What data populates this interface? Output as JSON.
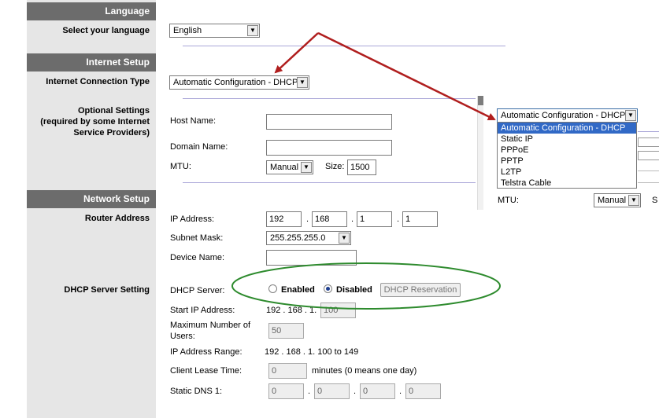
{
  "sections": {
    "language": "Language",
    "internet_setup": "Internet Setup",
    "network_setup": "Network Setup"
  },
  "side_labels": {
    "select_language": "Select your language",
    "connection_type": "Internet Connection Type",
    "optional_settings": "Optional Settings",
    "optional_note_1": "(required by some Internet",
    "optional_note_2": "Service Providers)",
    "router_address": "Router Address",
    "dhcp_server_setting": "DHCP Server Setting"
  },
  "language_select": {
    "value": "English"
  },
  "connection_select": {
    "value": "Automatic Configuration - DHCP"
  },
  "optional": {
    "host_name_label": "Host Name:",
    "domain_name_label": "Domain Name:",
    "mtu_label": "MTU:",
    "mtu_value": "Manual",
    "size_label": "Size:",
    "size_value": "1500"
  },
  "popup": {
    "value": "Automatic Configuration - DHCP",
    "options": [
      "Automatic Configuration - DHCP",
      "Static IP",
      "PPPoE",
      "PPTP",
      "L2TP",
      "Telstra Cable"
    ],
    "mtu_label": "MTU:",
    "mtu_value": "Manual",
    "partial_s": "S"
  },
  "router": {
    "ip_label": "IP Address:",
    "ip": [
      "192",
      "168",
      "1",
      "1"
    ],
    "subnet_label": "Subnet Mask:",
    "subnet_value": "255.255.255.0",
    "device_label": "Device Name:"
  },
  "dhcp": {
    "server_label": "DHCP Server:",
    "enabled_label": "Enabled",
    "disabled_label": "Disabled",
    "reservation_button": "DHCP Reservation",
    "start_ip_label": "Start IP  Address:",
    "start_ip_prefix": "192 . 168 . 1.",
    "start_ip_value": "100",
    "max_users_label_1": "Maximum Number of",
    "max_users_label_2": "Users:",
    "max_users_value": "50",
    "range_label": "IP Address Range:",
    "range_value": "192 . 168 . 1. 100 to 149",
    "lease_label": "Client Lease Time:",
    "lease_value": "0",
    "lease_suffix": "minutes (0 means one day)",
    "dns1_label": "Static DNS 1:",
    "dns1": [
      "0",
      "0",
      "0",
      "0"
    ]
  },
  "colors": {
    "section_header": "#6c6c6c",
    "sidebar": "#e6e6e6",
    "divider": "#a9a6d8",
    "arrow": "#b01e1e",
    "highlight_ellipse": "#2e8b2e",
    "dropdown_selection": "#3169c6"
  },
  "radio_state": {
    "enabled": false,
    "disabled": true
  }
}
